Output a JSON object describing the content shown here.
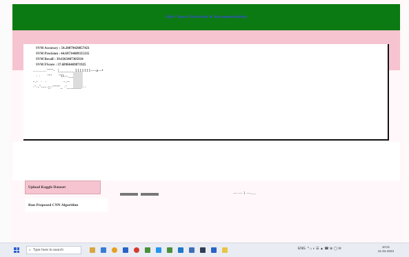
{
  "window": {
    "title": "Skin Cancer Detection & Recommendation",
    "results_lines": [
      "SVM Accuracy : 54.20879420857421",
      "SVM Precision : 44.69734489355335",
      "SVM Recall : 39.6363487305934",
      "SVM FScore : 37.68966469871925"
    ],
    "scrawl_lines": [
      "..........''''''-  |______ 1111111---a--•",
      "  · ·     ''''     ''O.-.___□",
      "-.-  ·  ·            -.--",
      "·'·-ˇ---·;;·'''''''_ ·'______···"
    ],
    "dim_text_right": "— — 1 —.....",
    "buttons": {
      "upload": "Upload Kaggle Dataset",
      "run_cnn": "Run Proposed CNN Algorithm"
    }
  },
  "taskbar": {
    "search_placeholder": "Type here to search",
    "tray_text": "ENG  ^ ⌂ ◐ ☰ ▲ ☎ ⊕ ◯ ✉",
    "time": "10:21",
    "date": "21-04-2023"
  },
  "colors": {
    "title_bar": "#0b7a12",
    "title_text": "#3a4fd8",
    "pink": "#f6c4d0"
  }
}
